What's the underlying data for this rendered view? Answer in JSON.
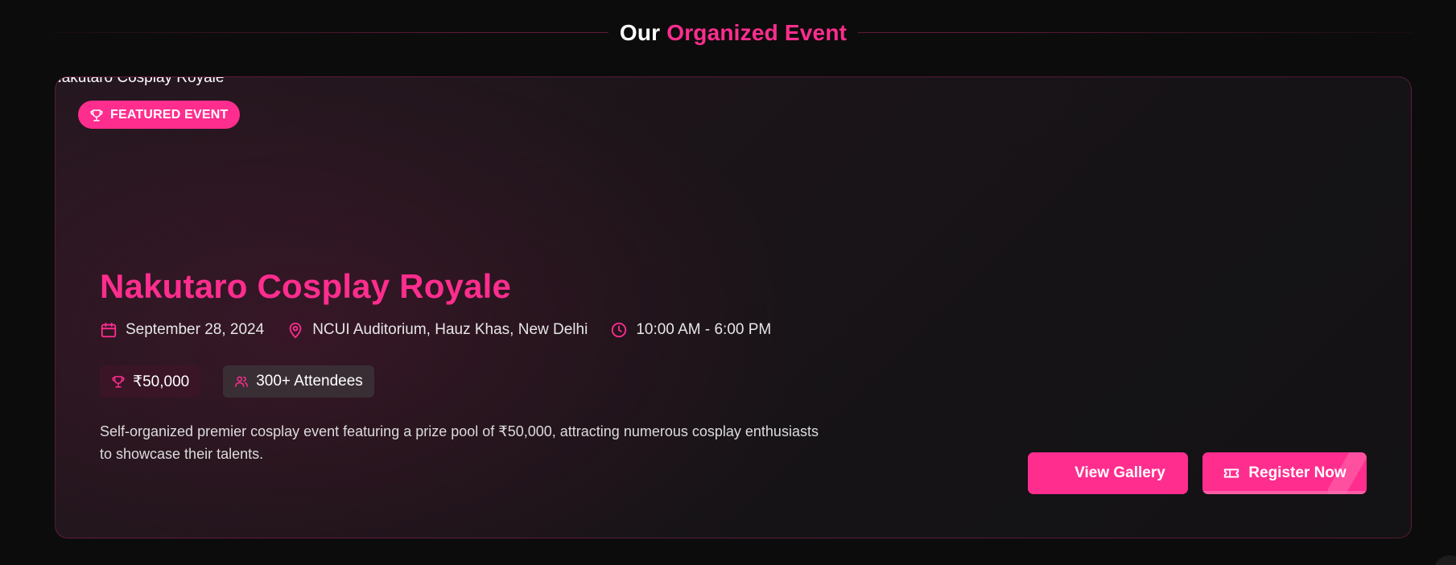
{
  "section": {
    "title_prefix": "Our",
    "title_highlight": "Organized Event"
  },
  "event": {
    "image_alt": "Nakutaro Cosplay Royale",
    "badge_label": "FEATURED EVENT",
    "title": "Nakutaro Cosplay Royale",
    "date": "September 28, 2024",
    "location": "NCUI Auditorium, Hauz Khas, New Delhi",
    "time": "10:00 AM - 6:00 PM",
    "prize": "₹50,000",
    "attendees": "300+ Attendees",
    "description": "Self-organized premier cosplay event featuring a prize pool of ₹50,000, attracting numerous cosplay enthusiasts to showcase their talents."
  },
  "actions": {
    "gallery_label": "View Gallery",
    "register_label": "Register Now"
  },
  "colors": {
    "accent": "#ff2d8e",
    "background": "#0c0c0c"
  },
  "icons": {
    "badge": "trophy-icon",
    "date": "calendar-icon",
    "location": "map-pin-icon",
    "time": "clock-icon",
    "prize": "trophy-icon",
    "attendees": "users-icon",
    "register": "ticket-icon"
  }
}
